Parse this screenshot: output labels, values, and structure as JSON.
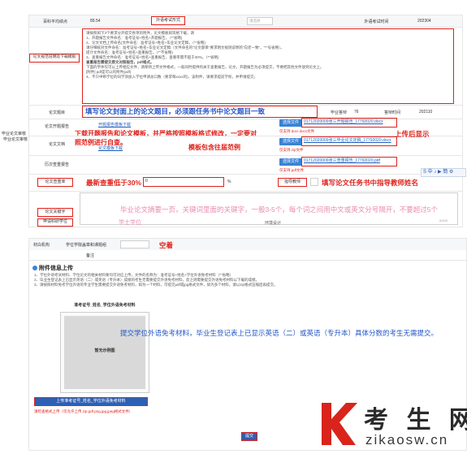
{
  "top_row": {
    "score_label": "百科平均绩点",
    "score_value": "89.54",
    "foreign_method_label": "外语考试形式",
    "foreign_method_value": "请选择",
    "foreign_score_label": "外语考试时间",
    "foreign_score_value": "202304"
  },
  "instructions": {
    "section_label": "论文规范说明及下载模板",
    "lines": [
      "请按照如下3个要求分开提交各项的附件，论文模板如资格下载，请",
      "1、开题报告文件命名：准考证号+姓名+开题报告。（*\"省略)",
      "2、论文文档上传命名(文件命名：准考证号+姓名+毕业论文定稿，（*\"省略)",
      "请仔细核对文件命名：准考证号+姓名+毕业论文定稿（文件命名的\"论文题目\"要求明文规则说明的\"向老一致\"，\"*\"号省略）。",
      "提计文件命名：准考证号+姓名+查重报告。（*\"不省略)",
      "3、查重报告文件命名：准考证号+姓名+查重报告，查重率需不超于30%。（*\"省略)",
      "查重报告需提交原文对照报告，pdf格式。",
      "下面的字体仅可以上传相应文件，请保持上传文件格式，一般同时提供的关于查重报告，论文，开题报告为必须提交，不要把其他文件放到论文上。",
      "[附件] pdf是可以的附件(pdf)",
      "4、不只中断学位的同学添加入学位申请总口数（要求每xxxx的)，该附件，请要求提前学校，并申请提交。"
    ],
    "note_extra": "请上传毕业学位申请表，不要在此栏提交其他材料"
  },
  "thesis": {
    "sidebar_label": "毕业论文审核",
    "title_label": "论文题目",
    "title_hint": "填写论文封面上的论文题目，必须跟任务书中论文题目一致",
    "report_label": "论文开题报告",
    "report_hint": "下载开题报告和论文模板，并严格按照模板格式修改，一定要对照范例进行自查。",
    "template_hint": "模板包含往届范例",
    "report_links": [
      "开题报告模板下载",
      "论文模板下载"
    ],
    "doc_label": "论文文档",
    "history_label": "历次查重报告",
    "defense_label": "毕业答辩",
    "defense_score": "76",
    "defense_time_label": "答辩时间",
    "defense_time_value": "202110",
    "files": [
      {
        "button": "选择文件",
        "name": "01712020009张三开题报告_17792020.docx",
        "hint": "仅支持.doc/.docx文件"
      },
      {
        "button": "选择文件",
        "name": "01712020009张三毕业论文定稿_17792020.docx",
        "hint": "仅支持.zip文件"
      },
      {
        "button": "选择文件",
        "name": "01712020009张三查重报告_17792020.pdf",
        "hint": "仅支持.pdf文件"
      }
    ],
    "upload_hint": "上传后显示",
    "similarity_label": "论文查重率",
    "similarity_value": "0",
    "similarity_unit": "%",
    "similarity_hint": "最新查重低于30%",
    "advisor_label": "指导教师",
    "advisor_hint": "填写论文任务书中指导教师姓名",
    "keywords_label": "论文关键字",
    "keywords_hint": "毕业论文摘要一页，关键词里面的关键字，一般3-5个，每个词之间用中文或英文分号隔开，不要超过5个",
    "keywords_counter": "0/200",
    "degree_label": "申请科研学位",
    "degree_value": "学士学位",
    "degree_extra": "环境设计",
    "ime_toolbar": "S 中 ♪ ▶ 簡 ⚙"
  },
  "lower": {
    "row1_label": "材白机构",
    "row1_text": "学位学院盖章和课题组",
    "row1_value": "空着",
    "row2_label": "备注",
    "attach_title": "附件信息上传",
    "attach_lines": [
      "1、学位外语考试材料、学位论文的相关材料要均可对应上传，文件的名称为：准考证号+姓名+学位外语免考材料（*\"省略）",
      "2、毕业生登记表上已显示英语（二）或英语（专升本）成绩的考生无需要提交外语免考材料，反之则需要提交外语免考材料以下载的成绩。",
      "3、请按照材料免考学位外语的专业学生需要提交外语免考材料，如为一个材料，可提交pdf或jpg格式文件，如为多个材料，请以zip格式压缩后再提交。"
    ],
    "card_title": "准考证号_姓名_学位外语免考材料",
    "card_placeholder": "暂无示例图",
    "card_button": "上传准考证号_姓名_学位外语免考材料",
    "card_note": "请检查格式上传（仅允许上传.zip.pdf.png.jpg.jpeg格式文件）",
    "annotation": "提交学位外语免考材料，毕业生登记表上已显示英语（二）或英语（专升本）具体分数的考生无需提交。",
    "submit_label": "提交"
  },
  "watermark": {
    "cn": "考 生 网",
    "url": "zikaosw.cn"
  },
  "colors": {
    "annotation_red": "#e0211b",
    "annotation_blue": "#2356c7",
    "annotation_pink": "#e98bb0",
    "button_blue": "#3b82d6",
    "link_blue": "#1f5fbf",
    "logo_red": "#d9241c"
  }
}
